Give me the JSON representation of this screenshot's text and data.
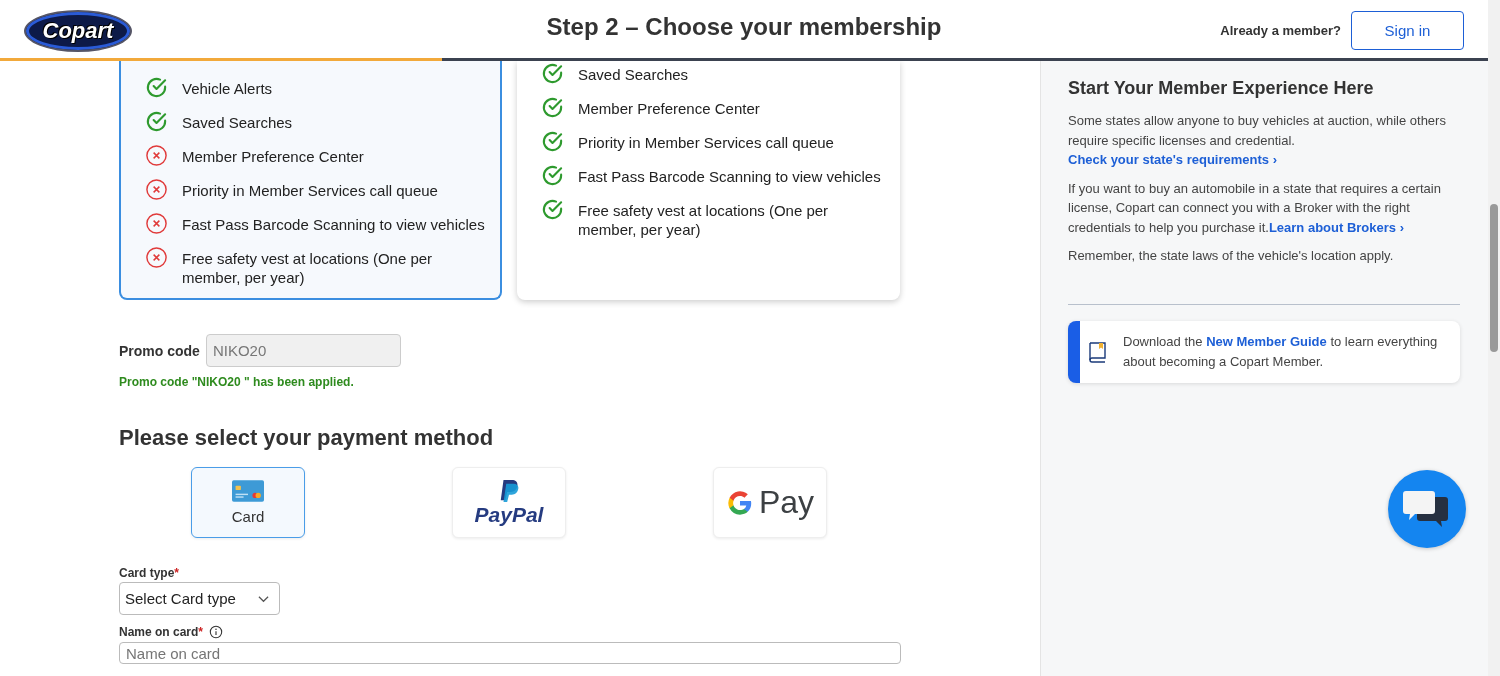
{
  "header": {
    "logo": "Copart",
    "title": "Step 2 – Choose your membership",
    "member_prompt": "Already a member?",
    "sign_in": "Sign in",
    "progress": {
      "level": 0.297
    }
  },
  "plans": [
    {
      "selected": true,
      "features": [
        {
          "label": "Vehicle Alerts",
          "included": true
        },
        {
          "label": "Saved Searches",
          "included": true
        },
        {
          "label": "Member Preference Center",
          "included": false
        },
        {
          "label": "Priority in Member Services call queue",
          "included": false
        },
        {
          "label": "Fast Pass Barcode Scanning to view vehicles",
          "included": false
        },
        {
          "label": "Free safety vest at locations (One per member, per year)",
          "included": false
        }
      ]
    },
    {
      "selected": false,
      "features": [
        {
          "label": "Saved Searches",
          "included": true
        },
        {
          "label": "Member Preference Center",
          "included": true
        },
        {
          "label": "Priority in Member Services call queue",
          "included": true
        },
        {
          "label": "Fast Pass Barcode Scanning to view vehicles",
          "included": true
        },
        {
          "label": "Free safety vest at locations (One per member, per year)",
          "included": true
        }
      ]
    }
  ],
  "promo": {
    "label": "Promo code",
    "value": "NIKO20",
    "message": "Promo code \"NIKO20 \" has been applied."
  },
  "payment": {
    "heading": "Please select your payment method",
    "methods": [
      {
        "kind": "card",
        "label": "Card",
        "selected": true
      },
      {
        "kind": "paypal",
        "label": "PayPal",
        "selected": false
      },
      {
        "kind": "gpay",
        "label": "Pay",
        "selected": false
      }
    ]
  },
  "card_type": {
    "label": "Card type",
    "required": "*",
    "value": "Select Card type"
  },
  "name_on_card": {
    "label": "Name on card",
    "required": "*",
    "placeholder": "Name on card"
  },
  "sidebar": {
    "heading": "Start Your Member Experience Here",
    "paragraphs": [
      {
        "text": "Some states allow anyone to buy vehicles at auction, while others require specific licenses and credential. ",
        "link": "Check your state's requirements ›"
      },
      {
        "text": "If you want to buy an automobile in a state that requires a certain license, Copart can connect you with a Broker with the right credentials to help you purchase it.",
        "link": "Learn about Brokers ›"
      },
      {
        "text": "Remember, the state laws of the vehicle's location apply."
      }
    ],
    "guide": {
      "before": "Download the ",
      "link": "New Member Guide",
      "after": " to learn everything about becoming a Copart Member."
    }
  }
}
